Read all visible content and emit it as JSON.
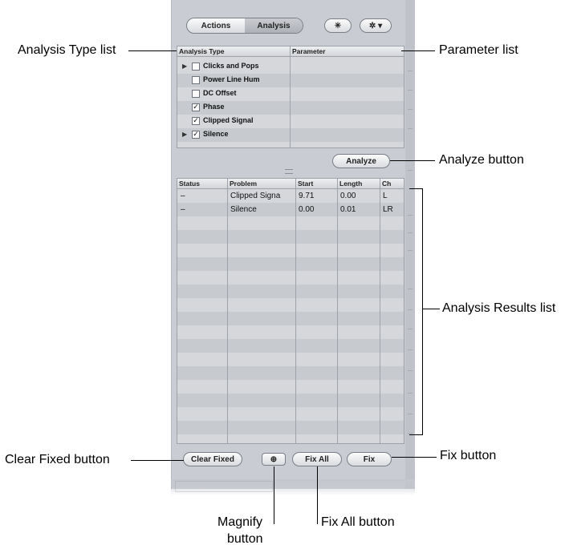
{
  "toolbar": {
    "tabs": [
      {
        "label": "Actions",
        "selected": false
      },
      {
        "label": "Analysis",
        "selected": true
      }
    ],
    "star_glyph": "✳",
    "gear_glyph": "✲ ▾"
  },
  "analysis_types": {
    "columns": [
      "Analysis Type",
      "Parameter"
    ],
    "rows": [
      {
        "label": "Clicks and Pops",
        "checked": false,
        "expandable": true
      },
      {
        "label": "Power Line Hum",
        "checked": false,
        "expandable": false
      },
      {
        "label": "DC Offset",
        "checked": false,
        "expandable": false
      },
      {
        "label": "Phase",
        "checked": true,
        "expandable": false
      },
      {
        "label": "Clipped Signal",
        "checked": true,
        "expandable": false
      },
      {
        "label": "Silence",
        "checked": true,
        "expandable": true
      }
    ]
  },
  "analyze_button": "Analyze",
  "results": {
    "columns": [
      "Status",
      "Problem",
      "Start",
      "Length",
      "Ch"
    ],
    "rows": [
      [
        "–",
        "Clipped Signa",
        "9.71",
        "0.00",
        "L"
      ],
      [
        "–",
        "Silence",
        "0.00",
        "0.01",
        "LR"
      ]
    ]
  },
  "bottom_buttons": {
    "clear_fixed": "Clear Fixed",
    "magnify_glyph": "⊕",
    "fix_all": "Fix All",
    "fix": "Fix"
  },
  "callouts": {
    "analysis_type_list": "Analysis Type list",
    "parameter_list": "Parameter list",
    "analyze_button": "Analyze button",
    "analysis_results_list": "Analysis Results list",
    "clear_fixed_button": "Clear Fixed button",
    "fix_button": "Fix button",
    "magnify_button_line1": "Magnify",
    "magnify_button_line2": "button",
    "fix_all_button": "Fix All button"
  }
}
